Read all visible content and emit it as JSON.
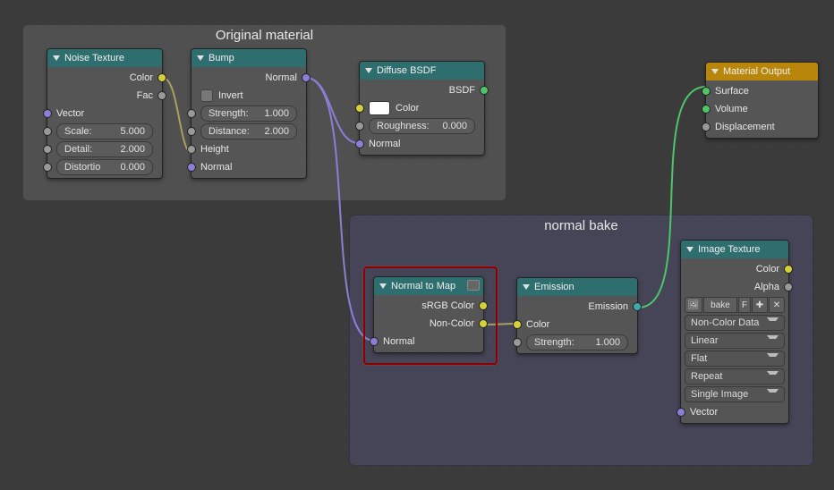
{
  "frames": {
    "original": {
      "title": "Original material"
    },
    "bake": {
      "title": "normal bake"
    }
  },
  "noise": {
    "title": "Noise Texture",
    "out_color": "Color",
    "out_fac": "Fac",
    "in_vector": "Vector",
    "scale_label": "Scale:",
    "scale_value": "5.000",
    "detail_label": "Detail:",
    "detail_value": "2.000",
    "distortion_label": "Distortio",
    "distortion_value": "0.000"
  },
  "bump": {
    "title": "Bump",
    "out_normal": "Normal",
    "invert": "Invert",
    "strength_label": "Strength:",
    "strength_value": "1.000",
    "distance_label": "Distance:",
    "distance_value": "2.000",
    "in_height": "Height",
    "in_normal": "Normal"
  },
  "diffuse": {
    "title": "Diffuse BSDF",
    "out_bsdf": "BSDF",
    "color_label": "Color",
    "roughness_label": "Roughness:",
    "roughness_value": "0.000",
    "in_normal": "Normal"
  },
  "matout": {
    "title": "Material Output",
    "surface": "Surface",
    "volume": "Volume",
    "displacement": "Displacement"
  },
  "n2map": {
    "title": "Normal to Map",
    "out_srgb": "sRGB Color",
    "out_noncolor": "Non-Color",
    "in_normal": "Normal"
  },
  "emission": {
    "title": "Emission",
    "out_emission": "Emission",
    "in_color": "Color",
    "strength_label": "Strength:",
    "strength_value": "1.000"
  },
  "imgtex": {
    "title": "Image Texture",
    "out_color": "Color",
    "out_alpha": "Alpha",
    "img_name": "bake",
    "img_f": "F",
    "dd_colorspace": "Non-Color Data",
    "dd_interp": "Linear",
    "dd_proj": "Flat",
    "dd_ext": "Repeat",
    "dd_source": "Single Image",
    "in_vector": "Vector"
  }
}
